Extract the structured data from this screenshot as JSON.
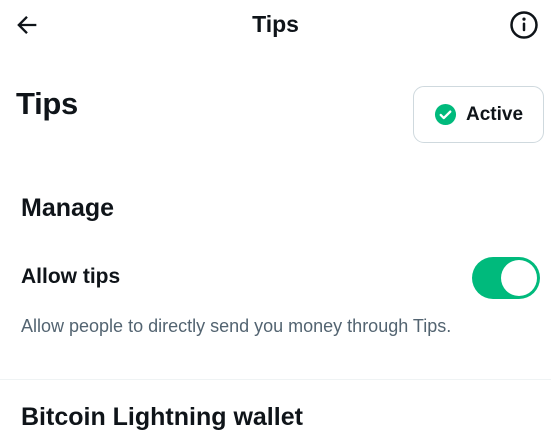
{
  "header": {
    "title": "Tips",
    "back_icon": "arrow-left-icon",
    "info_icon": "info-icon"
  },
  "main": {
    "heading": "Tips",
    "status": {
      "label": "Active",
      "icon": "check-circle-icon",
      "color": "#00ba7c"
    },
    "manage": {
      "title": "Manage",
      "allow_tips": {
        "label": "Allow tips",
        "description": "Allow people to directly send you money through Tips.",
        "enabled": true,
        "toggle_color": "#00ba7c"
      }
    },
    "wallet": {
      "title": "Bitcoin Lightning wallet"
    }
  }
}
